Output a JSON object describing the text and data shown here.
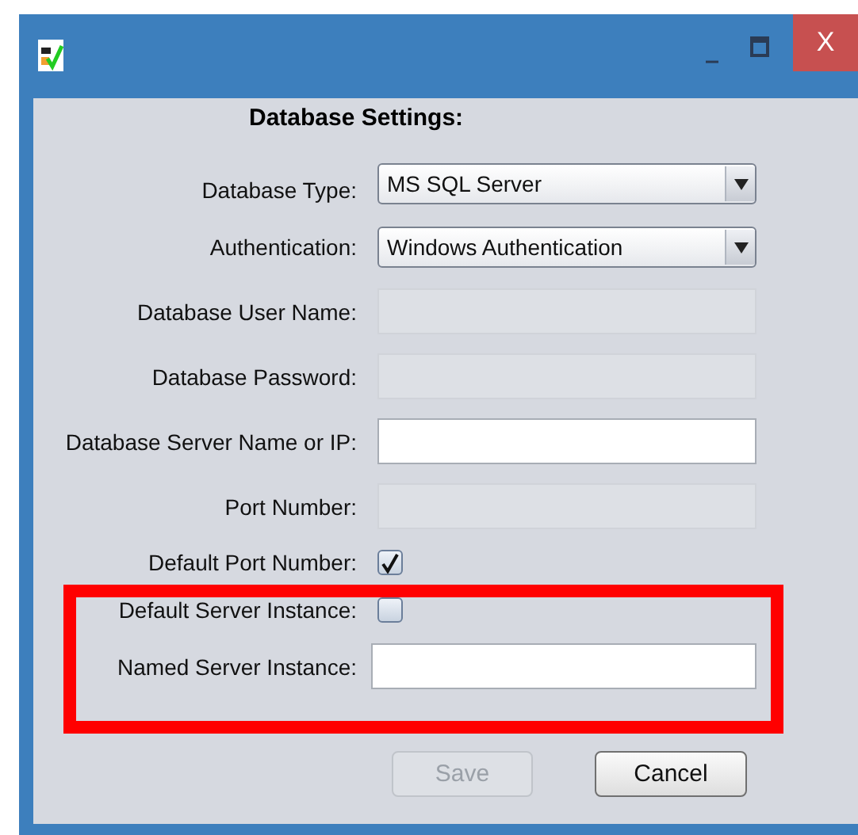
{
  "window": {
    "title_buttons": [
      "_",
      "X"
    ]
  },
  "heading": "Database Settings:",
  "fields": [
    {
      "kind": "dropdown",
      "label": "Database Type:",
      "value": "MS SQL Server"
    },
    {
      "kind": "dropdown",
      "label": "Authentication:",
      "value": "Windows Authentication"
    },
    {
      "kind": "text",
      "label": "Database User Name:",
      "disabled": true
    },
    {
      "kind": "text",
      "label": "Database Password:",
      "disabled": true
    },
    {
      "kind": "text",
      "label": "Database Server Name or IP:",
      "disabled": false
    },
    {
      "kind": "text",
      "label": "Port Number:",
      "disabled": true
    },
    {
      "kind": "checkbox",
      "label": "Default Port Number:",
      "checked": true
    },
    {
      "kind": "checkbox",
      "label": "Default Server Instance:",
      "checked": false
    },
    {
      "kind": "text",
      "label": "Named Server Instance:",
      "disabled": false
    }
  ],
  "buttons": [
    {
      "label": "Save",
      "disabled": true
    },
    {
      "label": "Cancel",
      "disabled": false
    }
  ]
}
